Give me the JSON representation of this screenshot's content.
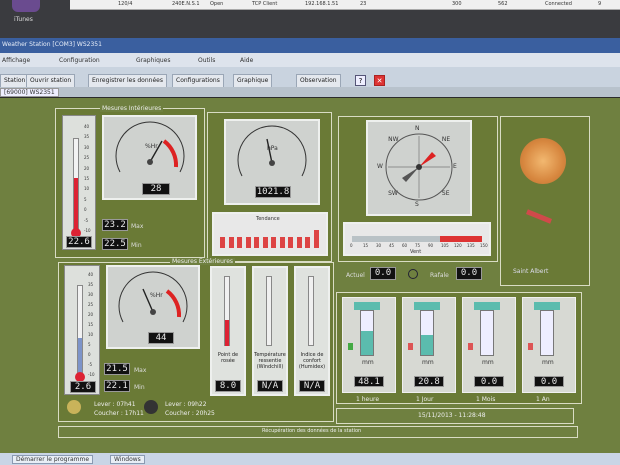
{
  "top_strip": {
    "app_label": "iTunes",
    "row": [
      "120/4",
      "240E.N.S.1",
      "Open",
      "TCP Client",
      "192.168.1.51",
      "23",
      "300",
      "562",
      "Connected",
      "9"
    ]
  },
  "window": {
    "title": "Weather Station [COM3] WS2351",
    "menu": [
      "Affichage",
      "Configuration",
      "Graphiques",
      "Outils",
      "Aide"
    ],
    "toolbar": [
      "Station",
      "Ouvrir station",
      "Enregistrer les données",
      "Configurations",
      "Graphique",
      "Observation"
    ],
    "tab": "[69000] WS2351"
  },
  "sections": {
    "indoor": "Mesures Intérieures",
    "outdoor": "Mesures Extérieures"
  },
  "indoor": {
    "temp": "22.6",
    "humidity_label": "%Hr",
    "humidity": "28",
    "max": "23.2",
    "min": "22.5",
    "max_label": "Max",
    "min_label": "Min",
    "temp_scale": [
      "40",
      "35",
      "30",
      "25",
      "20",
      "15",
      "10",
      "5",
      "0",
      "-5",
      "-10"
    ],
    "unit": "°C"
  },
  "pressure": {
    "unit": "hPa",
    "value": "1021.8",
    "trend_label": "Tendance",
    "trend_bars": [
      0.55,
      0.55,
      0.55,
      0.55,
      0.55,
      0.55,
      0.55,
      0.55,
      0.55,
      0.55,
      0.55,
      0.9
    ]
  },
  "wind": {
    "dirs": [
      "N",
      "NE",
      "E",
      "SE",
      "S",
      "SW",
      "W",
      "NW"
    ],
    "speed_label": "Vent",
    "actuel_label": "Actuel",
    "actuel": "0.0",
    "rafale_label": "Rafale",
    "rafale": "0.0",
    "scale": [
      "0",
      "15",
      "30",
      "45",
      "60",
      "75",
      "90",
      "105",
      "120",
      "135",
      "150"
    ]
  },
  "sun": {
    "label": "Saint Albert"
  },
  "outdoor": {
    "temp": "2.6",
    "humidity_label": "%Hr",
    "humidity": "44",
    "max": "21.5",
    "min": "22.1",
    "max_label": "Max",
    "min_label": "Min",
    "temp_scale": [
      "40",
      "35",
      "30",
      "25",
      "20",
      "15",
      "10",
      "5",
      "0",
      "-5",
      "-10"
    ],
    "dew_label": "Point de rosée",
    "dew_value": "8.0",
    "windchill_label": "Température ressentie (Windchill)",
    "windchill_value": "N/A",
    "heat_label": "Indice de confort (Humidex)",
    "heat_value": "N/A",
    "sunrise": "Lever : 07h41",
    "sunset": "Coucher : 17h11",
    "moonrise": "Lever : 09h22",
    "moonset": "Coucher : 20h25"
  },
  "rain": {
    "unit": "mm",
    "items": [
      {
        "label": "1 heure",
        "value": "48.1",
        "fill": 0.55
      },
      {
        "label": "1 Jour",
        "value": "20.8",
        "fill": 0.45
      },
      {
        "label": "1 Mois",
        "value": "0.0",
        "fill": 0.0
      },
      {
        "label": "1 An",
        "value": "0.0",
        "fill": 0.0
      }
    ]
  },
  "datetime": "15/11/2013 - 11:28:48",
  "status": "Récupération des données de la station",
  "taskbar": [
    "Démarrer le programme",
    "Windows"
  ]
}
